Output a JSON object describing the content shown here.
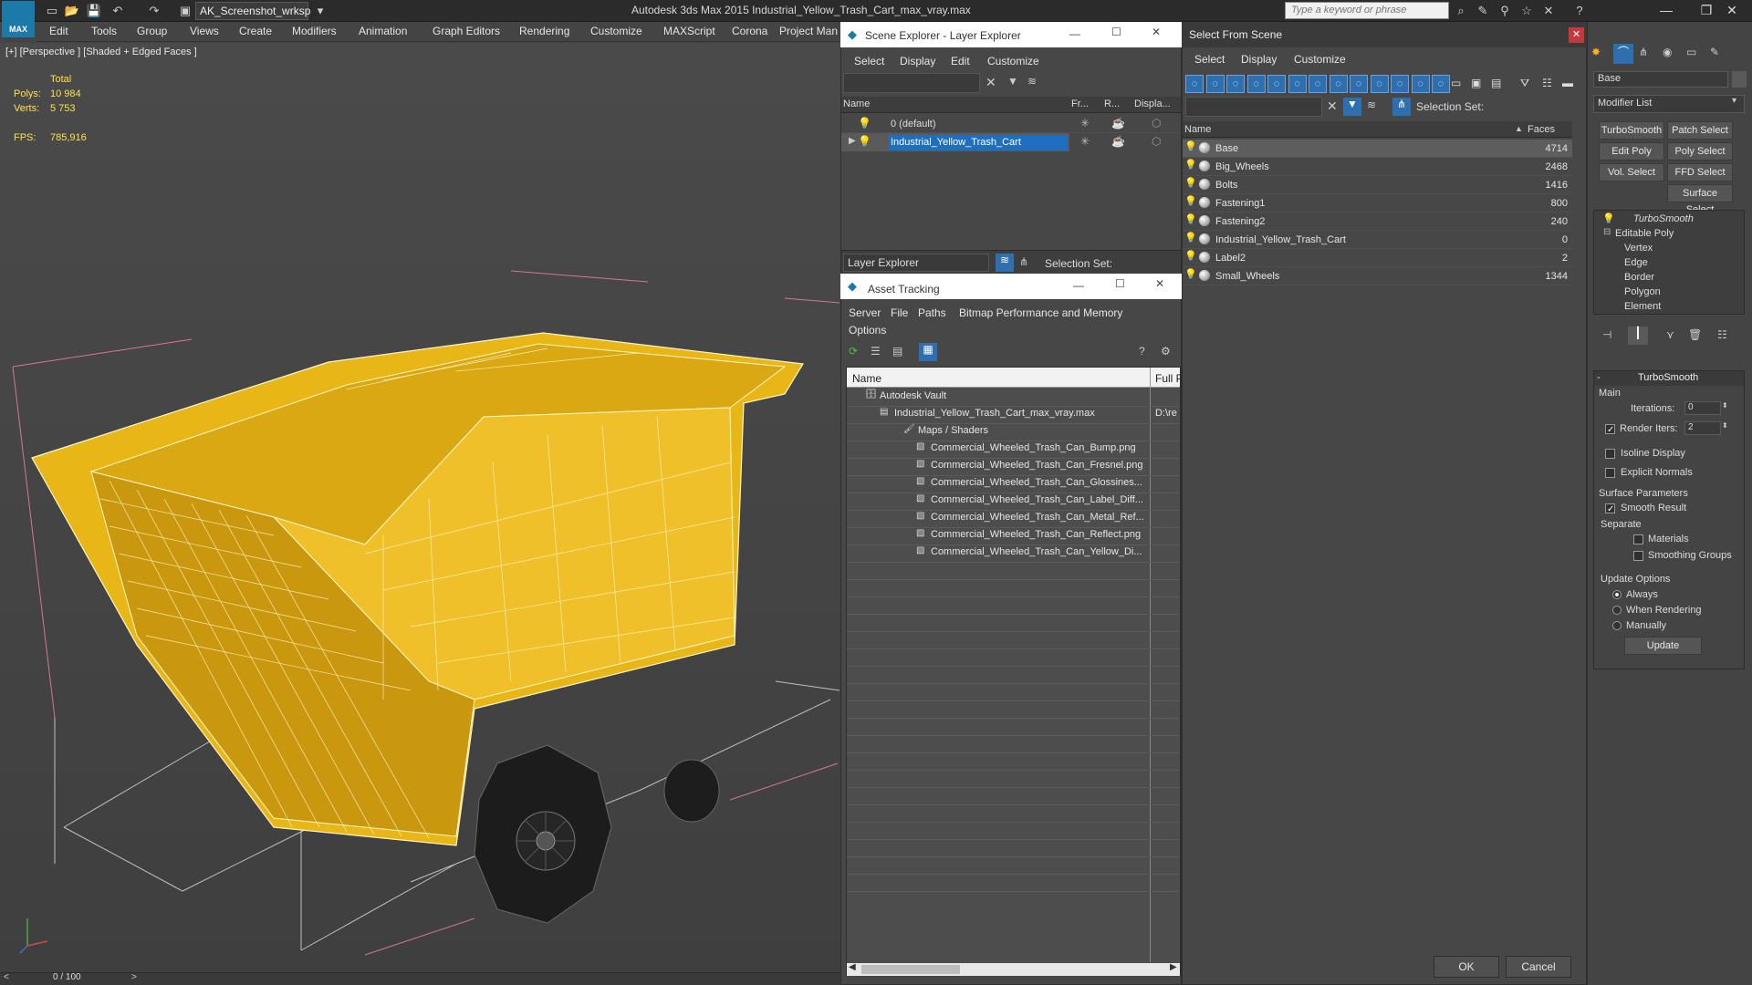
{
  "app": {
    "title": "Autodesk 3ds Max  2015     Industrial_Yellow_Trash_Cart_max_vray.max",
    "logo_text": "MAX",
    "workspace": "AK_Screenshot_wrksp",
    "search_placeholder": "Type a keyword or phrase"
  },
  "menubar": [
    "Edit",
    "Tools",
    "Group",
    "Views",
    "Create",
    "Modifiers",
    "Animation",
    "Graph Editors",
    "Rendering",
    "Customize",
    "MAXScript",
    "Corona",
    "Project Man"
  ],
  "viewport": {
    "label": "[+] [Perspective ] [Shaded + Edged Faces ]",
    "stats": {
      "total_label": "Total",
      "polys_label": "Polys:",
      "polys": "10 984",
      "verts_label": "Verts:",
      "verts": "5 753",
      "fps_label": "FPS:",
      "fps": "785,916"
    },
    "model_color": "#e8b617"
  },
  "timeline": {
    "frame": "0 / 100"
  },
  "scene_explorer": {
    "title": "Scene Explorer - Layer Explorer",
    "menu": [
      "Select",
      "Display",
      "Edit",
      "Customize"
    ],
    "columns": [
      "Name",
      "Fr...",
      "R...",
      "Displa..."
    ],
    "rows": [
      {
        "name": "0 (default)"
      },
      {
        "name": "Industrial_Yellow_Trash_Cart"
      }
    ],
    "footer_dropdown": "Layer Explorer",
    "footer_selection": "Selection Set:"
  },
  "asset_tracking": {
    "title": "Asset Tracking",
    "menu": [
      "Server",
      "File",
      "Paths",
      "Bitmap Performance and Memory"
    ],
    "menu2": "Options",
    "columns": [
      "Name",
      "Full P"
    ],
    "items": [
      {
        "name": "Autodesk Vault",
        "path": ""
      },
      {
        "name": "Industrial_Yellow_Trash_Cart_max_vray.max",
        "path": "D:\\re"
      },
      {
        "name": "Maps / Shaders",
        "path": ""
      },
      {
        "name": "Commercial_Wheeled_Trash_Can_Bump.png",
        "path": ""
      },
      {
        "name": "Commercial_Wheeled_Trash_Can_Fresnel.png",
        "path": ""
      },
      {
        "name": "Commercial_Wheeled_Trash_Can_Glossines...",
        "path": ""
      },
      {
        "name": "Commercial_Wheeled_Trash_Can_Label_Diff...",
        "path": ""
      },
      {
        "name": "Commercial_Wheeled_Trash_Can_Metal_Ref...",
        "path": ""
      },
      {
        "name": "Commercial_Wheeled_Trash_Can_Reflect.png",
        "path": ""
      },
      {
        "name": "Commercial_Wheeled_Trash_Can_Yellow_Di...",
        "path": ""
      }
    ]
  },
  "select_from_scene": {
    "title": "Select From Scene",
    "menu": [
      "Select",
      "Display",
      "Customize"
    ],
    "selection_set": "Selection Set:",
    "columns": [
      "Name",
      "Faces"
    ],
    "rows": [
      {
        "name": "Base",
        "faces": "4714"
      },
      {
        "name": "Big_Wheels",
        "faces": "2468"
      },
      {
        "name": "Bolts",
        "faces": "1416"
      },
      {
        "name": "Fastening1",
        "faces": "800"
      },
      {
        "name": "Fastening2",
        "faces": "240"
      },
      {
        "name": "Industrial_Yellow_Trash_Cart",
        "faces": "0"
      },
      {
        "name": "Label2",
        "faces": "2"
      },
      {
        "name": "Small_Wheels",
        "faces": "1344"
      }
    ],
    "ok": "OK",
    "cancel": "Cancel"
  },
  "command_panel": {
    "object_name": "Base",
    "modifier_list": "Modifier List",
    "buttons": [
      "TurboSmooth",
      "Patch Select",
      "Edit Poly",
      "Poly Select",
      "Vol. Select",
      "FFD Select",
      "Surface Select"
    ],
    "stack": [
      "TurboSmooth",
      "Editable Poly",
      "Vertex",
      "Edge",
      "Border",
      "Polygon",
      "Element"
    ],
    "rollout_title": "TurboSmooth",
    "main_label": "Main",
    "iterations_label": "Iterations:",
    "iterations": "0",
    "render_iters_label": "Render Iters:",
    "render_iters": "2",
    "isoline": "Isoline Display",
    "explicit_normals": "Explicit Normals",
    "surface_params": "Surface Parameters",
    "smooth_result": "Smooth Result",
    "separate": "Separate",
    "materials": "Materials",
    "smoothing_groups": "Smoothing Groups",
    "update_options": "Update Options",
    "always": "Always",
    "when_rendering": "When Rendering",
    "manually": "Manually",
    "update": "Update"
  }
}
